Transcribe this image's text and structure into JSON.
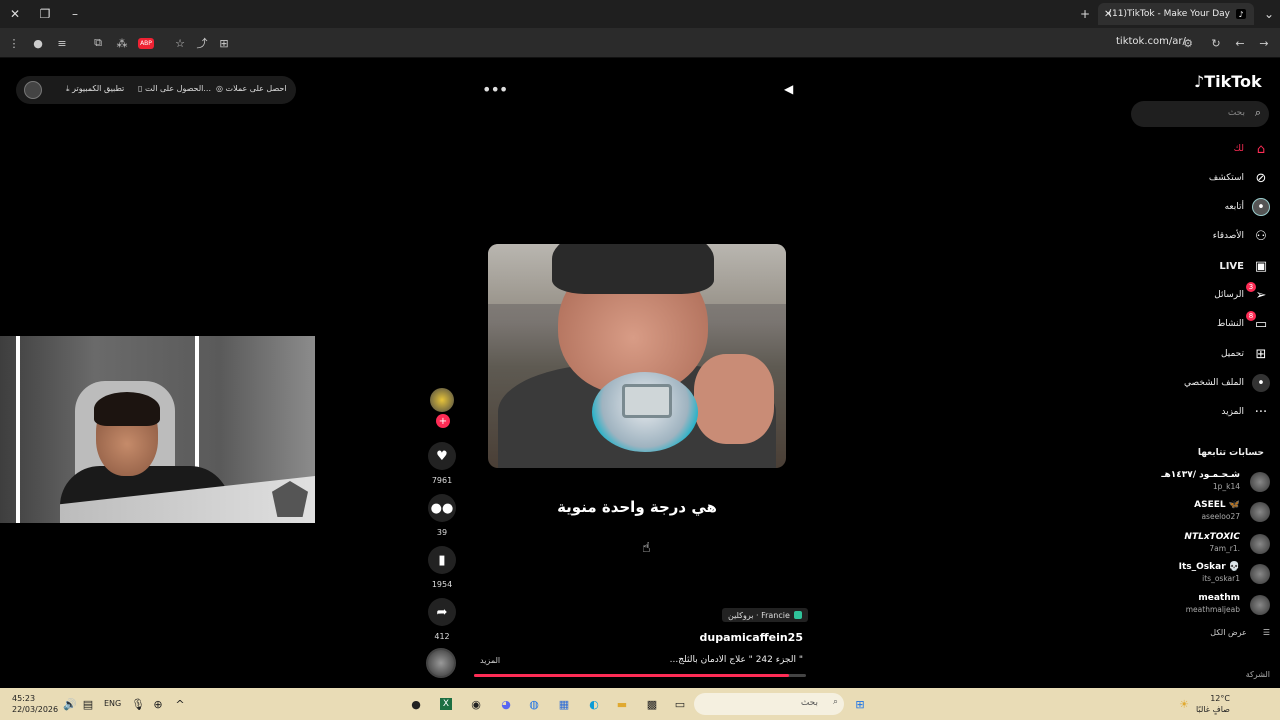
{
  "browser": {
    "tab_title": "(11)TikTok - Make Your Day",
    "url": "tiktok.com/ar/"
  },
  "topbar": {
    "get_coins": "احصل على عملات",
    "get_app": "الحصول على الت...",
    "pc_app": "تطبيق الكمبيوتر"
  },
  "video": {
    "caption": "هي درجة واحدة منوية",
    "location": "Francie · بروكلين",
    "author": "dupamicaffein25",
    "description": "\" الجزء 242 \" علاج الادمان بالثلج...",
    "more": "المزيد",
    "progress": 0.95
  },
  "actions": {
    "likes": "7961",
    "comments": "39",
    "saves": "1954",
    "shares": "412"
  },
  "sidebar": {
    "brand": "TikTok",
    "search_placeholder": "بحث",
    "nav": [
      {
        "label": "لك",
        "icon": "home-icon"
      },
      {
        "label": "استكشف",
        "icon": "compass-icon"
      },
      {
        "label": "أتابعه",
        "icon": "following-icon"
      },
      {
        "label": "الأصدقاء",
        "icon": "friends-icon"
      },
      {
        "label": "LIVE",
        "icon": "live-icon"
      },
      {
        "label": "الرسائل",
        "icon": "messages-icon",
        "badge": "3"
      },
      {
        "label": "النشاط",
        "icon": "activity-icon",
        "badge": "8"
      },
      {
        "label": "تحميل",
        "icon": "upload-icon"
      },
      {
        "label": "الملف الشخصي",
        "icon": "profile-icon"
      },
      {
        "label": "المزيد",
        "icon": "more-icon"
      }
    ],
    "following_title": "حسابات تتابعها",
    "accounts": [
      {
        "name": "شـحـمـود /١٤٣٧هـ",
        "handle": "1p_k14"
      },
      {
        "name": "ASEEL 🦋",
        "handle": "aseeloo27"
      },
      {
        "name": "NTLxTOXIC",
        "handle": "7am_r1."
      },
      {
        "name": "Its_Oskar 💀",
        "handle": "its_oskar1"
      },
      {
        "name": "meathm",
        "handle": "meathmaljeab"
      }
    ],
    "see_all": "عرض الكل",
    "company": "الشركة"
  },
  "taskbar": {
    "time": "45:23",
    "date": "22/03/2026",
    "lang": "ENG",
    "search": "بحث",
    "temp": "12°C",
    "weather": "صافٍ غالبًا"
  }
}
